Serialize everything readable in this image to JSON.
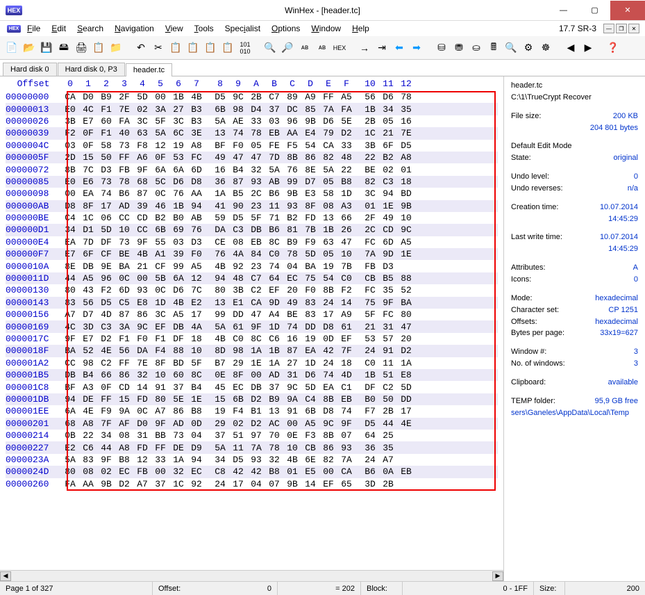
{
  "window": {
    "title": "WinHex - [header.tc]",
    "version": "17.7 SR-3"
  },
  "menus": [
    "File",
    "Edit",
    "Search",
    "Navigation",
    "View",
    "Tools",
    "Specialist",
    "Options",
    "Window",
    "Help"
  ],
  "tabs": [
    {
      "label": "Hard disk 0",
      "active": false
    },
    {
      "label": "Hard disk 0, P3",
      "active": false
    },
    {
      "label": "header.tc",
      "active": true
    }
  ],
  "hex": {
    "offset_label": "Offset",
    "columns": [
      "0",
      "1",
      "2",
      "3",
      "4",
      "5",
      "6",
      "7",
      "8",
      "9",
      "A",
      "B",
      "C",
      "D",
      "E",
      "F",
      "10",
      "11",
      "12"
    ],
    "rows": [
      {
        "off": "00000000",
        "b": [
          "CA",
          "D0",
          "B9",
          "2F",
          "5D",
          "00",
          "1B",
          "4B",
          "D5",
          "9C",
          "2B",
          "C7",
          "89",
          "A9",
          "FF",
          "A5",
          "56",
          "D6",
          "78"
        ]
      },
      {
        "off": "00000013",
        "b": [
          "E0",
          "4C",
          "F1",
          "7E",
          "02",
          "3A",
          "27",
          "B3",
          "6B",
          "98",
          "D4",
          "37",
          "DC",
          "85",
          "7A",
          "FA",
          "1B",
          "34",
          "35"
        ]
      },
      {
        "off": "00000026",
        "b": [
          "3B",
          "E7",
          "60",
          "FA",
          "3C",
          "5F",
          "3C",
          "B3",
          "5A",
          "AE",
          "33",
          "03",
          "96",
          "9B",
          "D6",
          "5E",
          "2B",
          "05",
          "16"
        ]
      },
      {
        "off": "00000039",
        "b": [
          "F2",
          "0F",
          "F1",
          "40",
          "63",
          "5A",
          "6C",
          "3E",
          "13",
          "74",
          "78",
          "EB",
          "AA",
          "E4",
          "79",
          "D2",
          "1C",
          "21",
          "7E"
        ]
      },
      {
        "off": "0000004C",
        "b": [
          "03",
          "0F",
          "58",
          "73",
          "F8",
          "12",
          "19",
          "A8",
          "BF",
          "F0",
          "05",
          "FE",
          "F5",
          "54",
          "CA",
          "33",
          "3B",
          "6F",
          "D5"
        ]
      },
      {
        "off": "0000005F",
        "b": [
          "2D",
          "15",
          "50",
          "FF",
          "A6",
          "0F",
          "53",
          "FC",
          "49",
          "47",
          "47",
          "7D",
          "8B",
          "86",
          "82",
          "48",
          "22",
          "B2",
          "A8"
        ]
      },
      {
        "off": "00000072",
        "b": [
          "8B",
          "7C",
          "D3",
          "FB",
          "9F",
          "6A",
          "6A",
          "6D",
          "16",
          "B4",
          "32",
          "5A",
          "76",
          "8E",
          "5A",
          "22",
          "BE",
          "02",
          "01"
        ]
      },
      {
        "off": "00000085",
        "b": [
          "E0",
          "E6",
          "73",
          "78",
          "68",
          "5C",
          "D6",
          "D8",
          "36",
          "87",
          "93",
          "AB",
          "99",
          "D7",
          "05",
          "B8",
          "82",
          "C3",
          "18"
        ]
      },
      {
        "off": "00000098",
        "b": [
          "00",
          "EA",
          "74",
          "B6",
          "87",
          "0C",
          "76",
          "AA",
          "1A",
          "B5",
          "2C",
          "B6",
          "9B",
          "E3",
          "58",
          "1D",
          "3C",
          "94",
          "BD"
        ]
      },
      {
        "off": "000000AB",
        "b": [
          "D8",
          "8F",
          "17",
          "AD",
          "39",
          "46",
          "1B",
          "94",
          "41",
          "90",
          "23",
          "11",
          "93",
          "8F",
          "08",
          "A3",
          "01",
          "1E",
          "9B"
        ]
      },
      {
        "off": "000000BE",
        "b": [
          "C4",
          "1C",
          "06",
          "CC",
          "CD",
          "B2",
          "B0",
          "AB",
          "59",
          "D5",
          "5F",
          "71",
          "B2",
          "FD",
          "13",
          "66",
          "2F",
          "49",
          "10"
        ]
      },
      {
        "off": "000000D1",
        "b": [
          "34",
          "D1",
          "5D",
          "10",
          "CC",
          "6B",
          "69",
          "76",
          "DA",
          "C3",
          "DB",
          "B6",
          "81",
          "7B",
          "1B",
          "26",
          "2C",
          "CD",
          "9C"
        ]
      },
      {
        "off": "000000E4",
        "b": [
          "EA",
          "7D",
          "DF",
          "73",
          "9F",
          "55",
          "03",
          "D3",
          "CE",
          "08",
          "EB",
          "8C",
          "B9",
          "F9",
          "63",
          "47",
          "FC",
          "6D",
          "A5"
        ]
      },
      {
        "off": "000000F7",
        "b": [
          "E7",
          "6F",
          "CF",
          "BE",
          "4B",
          "A1",
          "39",
          "F0",
          "76",
          "4A",
          "84",
          "C0",
          "78",
          "5D",
          "05",
          "10",
          "7A",
          "9D",
          "1E"
        ]
      },
      {
        "off": "0000010A",
        "b": [
          "8E",
          "DB",
          "9E",
          "BA",
          "21",
          "CF",
          "99",
          "A5",
          "4B",
          "92",
          "23",
          "74",
          "04",
          "BA",
          "19",
          "7B",
          "FB",
          "D3",
          " "
        ]
      },
      {
        "off": "0000011D",
        "b": [
          "44",
          "A5",
          "96",
          "0C",
          "00",
          "5B",
          "6A",
          "12",
          "94",
          "48",
          "C7",
          "64",
          "EC",
          "75",
          "54",
          "C0",
          "CB",
          "B5",
          "88"
        ]
      },
      {
        "off": "00000130",
        "b": [
          "80",
          "43",
          "F2",
          "6D",
          "93",
          "0C",
          "D6",
          "7C",
          "80",
          "3B",
          "C2",
          "EF",
          "20",
          "F0",
          "8B",
          "F2",
          "FC",
          "35",
          "52"
        ]
      },
      {
        "off": "00000143",
        "b": [
          "83",
          "56",
          "D5",
          "C5",
          "E8",
          "1D",
          "4B",
          "E2",
          "13",
          "E1",
          "CA",
          "9D",
          "49",
          "83",
          "24",
          "14",
          "75",
          "9F",
          "BA"
        ]
      },
      {
        "off": "00000156",
        "b": [
          "A7",
          "D7",
          "4D",
          "87",
          "86",
          "3C",
          "A5",
          "17",
          "99",
          "DD",
          "47",
          "A4",
          "BE",
          "83",
          "17",
          "A9",
          "5F",
          "FC",
          "80"
        ]
      },
      {
        "off": "00000169",
        "b": [
          "4C",
          "3D",
          "C3",
          "3A",
          "9C",
          "EF",
          "DB",
          "4A",
          "5A",
          "61",
          "9F",
          "1D",
          "74",
          "DD",
          "D8",
          "61",
          "21",
          "31",
          "47"
        ]
      },
      {
        "off": "0000017C",
        "b": [
          "9F",
          "E7",
          "D2",
          "F1",
          "F0",
          "F1",
          "DF",
          "18",
          "4B",
          "C0",
          "8C",
          "C6",
          "16",
          "19",
          "0D",
          "EF",
          "53",
          "57",
          "20"
        ]
      },
      {
        "off": "0000018F",
        "b": [
          "BA",
          "52",
          "4E",
          "56",
          "DA",
          "F4",
          "88",
          "10",
          "8D",
          "98",
          "1A",
          "1B",
          "87",
          "EA",
          "42",
          "7F",
          "24",
          "91",
          "D2"
        ]
      },
      {
        "off": "000001A2",
        "b": [
          "CC",
          "98",
          "C2",
          "FF",
          "7E",
          "8F",
          "BD",
          "5F",
          "B7",
          "29",
          "1E",
          "1A",
          "27",
          "1D",
          "24",
          "18",
          "C0",
          "11",
          "1A"
        ]
      },
      {
        "off": "000001B5",
        "b": [
          "DB",
          "B4",
          "66",
          "86",
          "32",
          "10",
          "60",
          "8C",
          "0E",
          "8F",
          "00",
          "AD",
          "31",
          "D6",
          "74",
          "4D",
          "1B",
          "51",
          "E8"
        ]
      },
      {
        "off": "000001C8",
        "b": [
          "BF",
          "A3",
          "0F",
          "CD",
          "14",
          "91",
          "37",
          "B4",
          "45",
          "EC",
          "DB",
          "37",
          "9C",
          "5D",
          "EA",
          "C1",
          "DF",
          "C2",
          "5D"
        ]
      },
      {
        "off": "000001DB",
        "b": [
          "94",
          "DE",
          "FF",
          "15",
          "FD",
          "80",
          "5E",
          "1E",
          "15",
          "6B",
          "D2",
          "B9",
          "9A",
          "C4",
          "8B",
          "EB",
          "B0",
          "50",
          "DD"
        ]
      },
      {
        "off": "000001EE",
        "b": [
          "6A",
          "4E",
          "F9",
          "9A",
          "0C",
          "A7",
          "86",
          "B8",
          "19",
          "F4",
          "B1",
          "13",
          "91",
          "6B",
          "D8",
          "74",
          "F7",
          "2B",
          "17"
        ]
      },
      {
        "off": "00000201",
        "b": [
          "68",
          "A8",
          "7F",
          "AF",
          "D0",
          "9F",
          "AD",
          "0D",
          "29",
          "02",
          "D2",
          "AC",
          "00",
          "A5",
          "9C",
          "9F",
          "D5",
          "44",
          "4E"
        ]
      },
      {
        "off": "00000214",
        "b": [
          "0B",
          "22",
          "34",
          "08",
          "31",
          "BB",
          "73",
          "04",
          "37",
          "51",
          "97",
          "70",
          "0E",
          "F3",
          "8B",
          "07",
          "64",
          "25",
          " "
        ]
      },
      {
        "off": "00000227",
        "b": [
          "E2",
          "C6",
          "44",
          "A8",
          "FD",
          "FF",
          "DE",
          "D9",
          "5A",
          "11",
          "7A",
          "78",
          "10",
          "CB",
          "86",
          "93",
          "36",
          "35",
          " "
        ]
      },
      {
        "off": "0000023A",
        "b": [
          "5A",
          "83",
          "9F",
          "B8",
          "12",
          "33",
          "1A",
          "94",
          "34",
          "D5",
          "93",
          "32",
          "4B",
          "6E",
          "82",
          "7A",
          "24",
          "A7",
          " "
        ]
      },
      {
        "off": "0000024D",
        "b": [
          "80",
          "08",
          "02",
          "EC",
          "FB",
          "00",
          "32",
          "EC",
          "C8",
          "42",
          "42",
          "B8",
          "01",
          "E5",
          "00",
          "CA",
          "B6",
          "0A",
          "EB"
        ]
      },
      {
        "off": "00000260",
        "b": [
          "FA",
          "AA",
          "9B",
          "D2",
          "A7",
          "37",
          "1C",
          "92",
          "24",
          "17",
          "04",
          "07",
          "9B",
          "14",
          "EF",
          "65",
          "3D",
          "2B",
          " "
        ]
      }
    ]
  },
  "info": {
    "filename": "header.tc",
    "path": "C:\\1\\TrueCrypt Recover",
    "filesize_label": "File size:",
    "filesize": "200 KB",
    "filesize_bytes": "204 801 bytes",
    "mode_label": "Default Edit Mode",
    "state_label": "State:",
    "state": "original",
    "undo_level_label": "Undo level:",
    "undo_level": "0",
    "undo_rev_label": "Undo reverses:",
    "undo_rev": "n/a",
    "ctime_label": "Creation time:",
    "ctime": "10.07.2014",
    "ctime2": "14:45:29",
    "mtime_label": "Last write time:",
    "mtime": "10.07.2014",
    "mtime2": "14:45:29",
    "attr_label": "Attributes:",
    "attr": "A",
    "icons_label": "Icons:",
    "icons": "0",
    "vmode_label": "Mode:",
    "vmode": "hexadecimal",
    "charset_label": "Character set:",
    "charset": "CP 1251",
    "offsets_label": "Offsets:",
    "offsets": "hexadecimal",
    "bpp_label": "Bytes per page:",
    "bpp": "33x19=627",
    "win_label": "Window #:",
    "win": "3",
    "nwin_label": "No. of windows:",
    "nwin": "3",
    "clip_label": "Clipboard:",
    "clip": "available",
    "temp_label": "TEMP folder:",
    "temp": "95,9 GB free",
    "temp_path": "sers\\Ganeles\\AppData\\Local\\Temp"
  },
  "status": {
    "page": "Page 1 of 327",
    "offset_label": "Offset:",
    "offset_val": "0",
    "eq": "= 202",
    "block_label": "Block:",
    "block_val": "0 - 1FF",
    "size_label": "Size:",
    "size_val": "200"
  }
}
